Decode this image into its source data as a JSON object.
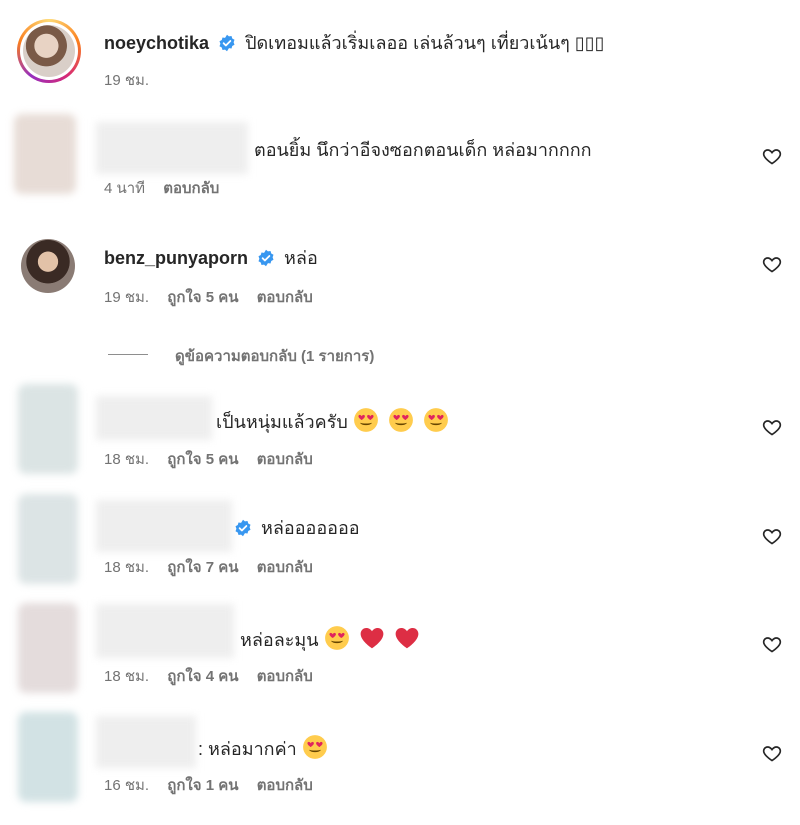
{
  "post": {
    "username": "noeychotika",
    "caption": "ปิดเทอมแล้วเริ่มเลออ เล่นล้วนๆ เที่ยวเน้นๆ",
    "caption_tail": "▯▯▯",
    "time": "19 ชม."
  },
  "comments": [
    {
      "username": "",
      "text": "ตอนยิ้ม นึกว่าอีจงซอกตอนเด็ก หล่อมากกกก",
      "time": "4 นาที",
      "likes": "",
      "reply": "ตอบกลับ"
    },
    {
      "username": "benz_punyaporn",
      "text": "หล่อ",
      "time": "19 ชม.",
      "likes": "ถูกใจ 5 คน",
      "reply": "ตอบกลับ"
    },
    {
      "username": "",
      "text": "เป็นหนุ่มแล้วครับ",
      "time": "18 ชม.",
      "likes": "ถูกใจ 5 คน",
      "reply": "ตอบกลับ"
    },
    {
      "username": "",
      "text": "หล่อออออออ",
      "time": "18 ชม.",
      "likes": "ถูกใจ 7 คน",
      "reply": "ตอบกลับ"
    },
    {
      "username": "",
      "text": "หล่อละมุน",
      "time": "18 ชม.",
      "likes": "ถูกใจ 4 คน",
      "reply": "ตอบกลับ"
    },
    {
      "username": "",
      "text": ": หล่อมากค่า",
      "time": "16 ชม.",
      "likes": "ถูกใจ 1 คน",
      "reply": "ตอบกลับ"
    }
  ],
  "view_replies": "ดูข้อความตอบกลับ (1 รายการ)",
  "colors": {
    "verified": "#3897f0",
    "meta": "#737373",
    "text": "#262626",
    "heart_red": "#ed1c24"
  },
  "icons": [
    "verified-badge-icon",
    "heart-outline-icon",
    "heart-eyes-emoji",
    "red-heart-emoji"
  ]
}
